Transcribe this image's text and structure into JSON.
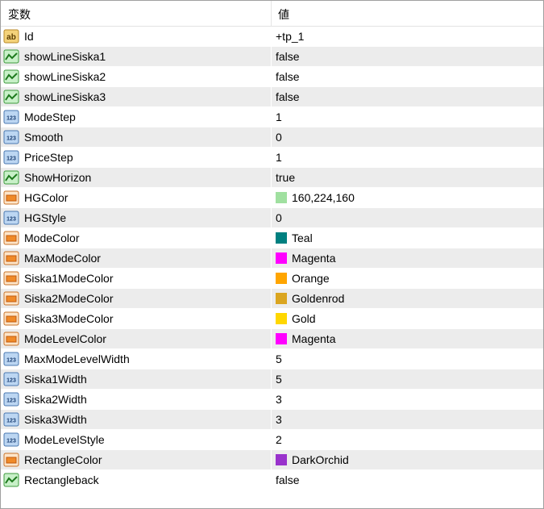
{
  "header": {
    "col_name": "変数",
    "col_value": "値"
  },
  "rows": [
    {
      "name": "Id",
      "value": "+tp_1",
      "icon": "ab-icon"
    },
    {
      "name": "showLineSiska1",
      "value": "false",
      "icon": "boolean-icon"
    },
    {
      "name": "showLineSiska2",
      "value": "false",
      "icon": "boolean-icon"
    },
    {
      "name": "showLineSiska3",
      "value": "false",
      "icon": "boolean-icon"
    },
    {
      "name": "ModeStep",
      "value": "1",
      "icon": "integer-icon"
    },
    {
      "name": "Smooth",
      "value": "0",
      "icon": "integer-icon"
    },
    {
      "name": "PriceStep",
      "value": "1",
      "icon": "integer-icon"
    },
    {
      "name": "ShowHorizon",
      "value": "true",
      "icon": "boolean-icon"
    },
    {
      "name": "HGColor",
      "value": "160,224,160",
      "icon": "color-icon",
      "color": "#a0e0a0"
    },
    {
      "name": "HGStyle",
      "value": "0",
      "icon": "integer-icon"
    },
    {
      "name": "ModeColor",
      "value": "Teal",
      "icon": "color-icon",
      "color": "#008080"
    },
    {
      "name": "MaxModeColor",
      "value": "Magenta",
      "icon": "color-icon",
      "color": "#ff00ff"
    },
    {
      "name": "Siska1ModeColor",
      "value": "Orange",
      "icon": "color-icon",
      "color": "#ffa500"
    },
    {
      "name": "Siska2ModeColor",
      "value": "Goldenrod",
      "icon": "color-icon",
      "color": "#daa520"
    },
    {
      "name": "Siska3ModeColor",
      "value": "Gold",
      "icon": "color-icon",
      "color": "#ffd700"
    },
    {
      "name": "ModeLevelColor",
      "value": "Magenta",
      "icon": "color-icon",
      "color": "#ff00ff"
    },
    {
      "name": "MaxModeLevelWidth",
      "value": "5",
      "icon": "integer-icon"
    },
    {
      "name": "Siska1Width",
      "value": "5",
      "icon": "integer-icon"
    },
    {
      "name": "Siska2Width",
      "value": "3",
      "icon": "integer-icon"
    },
    {
      "name": "Siska3Width",
      "value": "3",
      "icon": "integer-icon"
    },
    {
      "name": "ModeLevelStyle",
      "value": "2",
      "icon": "integer-icon"
    },
    {
      "name": "RectangleColor",
      "value": "DarkOrchid",
      "icon": "color-icon",
      "color": "#9932cc"
    },
    {
      "name": "Rectangleback",
      "value": "false",
      "icon": "boolean-icon"
    }
  ]
}
